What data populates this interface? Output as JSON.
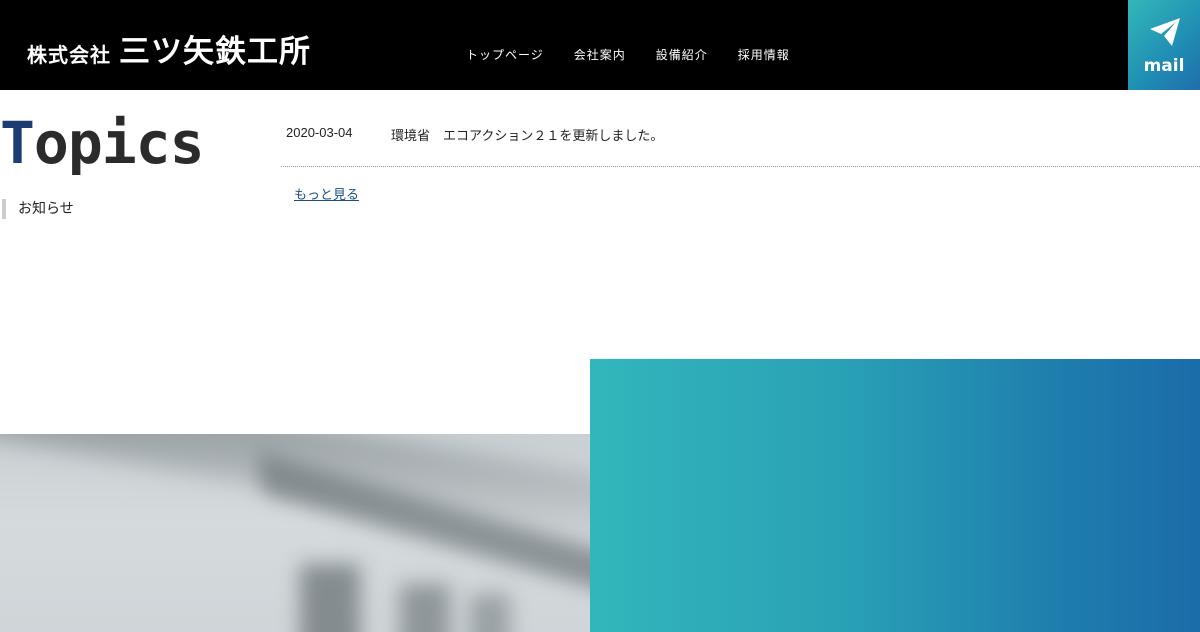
{
  "header": {
    "logo_prefix": "株式会社",
    "logo_name": "三ツ矢鉄工所",
    "nav": [
      {
        "label": "トップページ"
      },
      {
        "label": "会社案内"
      },
      {
        "label": "設備紹介"
      },
      {
        "label": "採用情報"
      }
    ],
    "mail_label": "mail",
    "mail_icon": "paper-plane-icon"
  },
  "topics": {
    "title_first": "T",
    "title_rest": "opics",
    "subtitle": "お知らせ",
    "items": [
      {
        "date": "2020-03-04",
        "text": "環境省　エコアクション２１を更新しました。"
      }
    ],
    "more_label": "もっと見る "
  },
  "colors": {
    "header_bg": "#000000",
    "accent_teal": "#32b6bb",
    "accent_blue": "#1b6ca8",
    "title_navy": "#1c3d74"
  }
}
